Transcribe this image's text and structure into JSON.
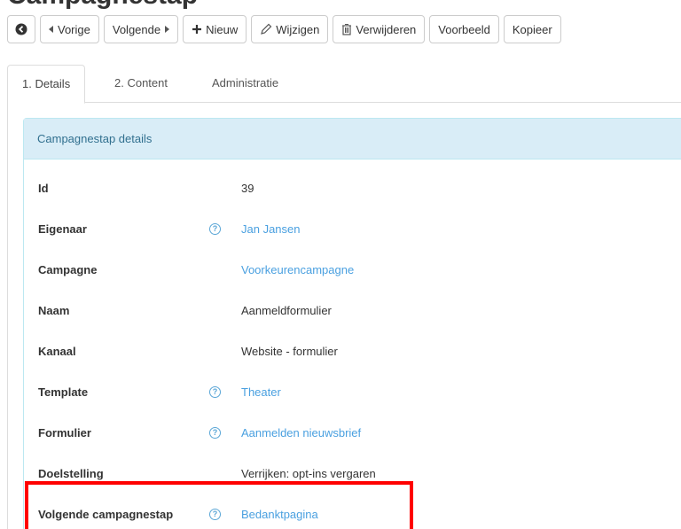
{
  "page": {
    "title": "Campagnestap"
  },
  "toolbar": {
    "back_icon": "circle-arrow-left-icon",
    "prev_label": "Vorige",
    "next_label": "Volgende",
    "new_label": "Nieuw",
    "edit_label": "Wijzigen",
    "delete_label": "Verwijderen",
    "preview_label": "Voorbeeld",
    "copy_label": "Kopieer"
  },
  "tabs": [
    {
      "label": "1. Details",
      "active": true
    },
    {
      "label": "2. Content",
      "active": false
    },
    {
      "label": "Administratie",
      "active": false
    }
  ],
  "panel": {
    "title": "Campagnestap details",
    "rows": [
      {
        "label": "Id",
        "value": "39",
        "help": false,
        "link": false
      },
      {
        "label": "Eigenaar",
        "value": "Jan Jansen",
        "help": true,
        "link": true
      },
      {
        "label": "Campagne",
        "value": "Voorkeurencampagne",
        "help": false,
        "link": true
      },
      {
        "label": "Naam",
        "value": "Aanmeldformulier",
        "help": false,
        "link": false
      },
      {
        "label": "Kanaal",
        "value": "Website - formulier",
        "help": false,
        "link": false
      },
      {
        "label": "Template",
        "value": "Theater",
        "help": true,
        "link": true
      },
      {
        "label": "Formulier",
        "value": "Aanmelden nieuwsbrief",
        "help": true,
        "link": true
      },
      {
        "label": "Doelstelling",
        "value": "Verrijken: opt-ins vergaren",
        "help": false,
        "link": false
      },
      {
        "label": "Volgende campagnestap",
        "value": "Bedanktpagina",
        "help": true,
        "link": true
      }
    ],
    "help_glyph": "?"
  },
  "colors": {
    "link": "#4aa0e0",
    "panel_heading_bg": "#d9edf7",
    "panel_heading_text": "#31708f",
    "highlight": "#ff0000"
  }
}
